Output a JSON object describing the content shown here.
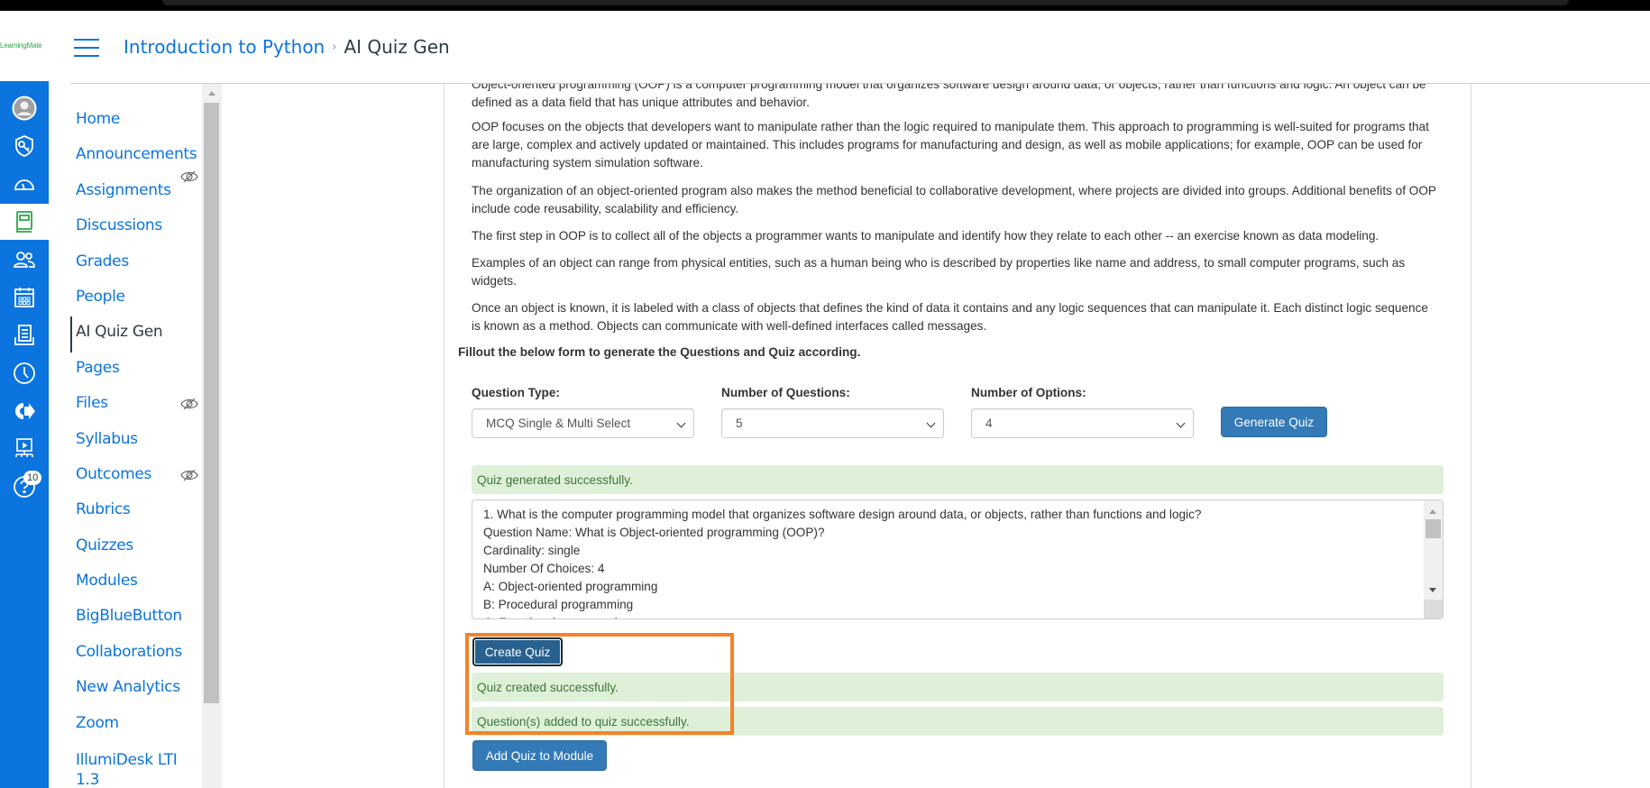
{
  "brand": {
    "logo_text": "LearningMate",
    "accent": "#0b74de",
    "highlight": "#f5822a"
  },
  "global_nav": {
    "items": [
      {
        "name": "account",
        "icon": "avatar-icon"
      },
      {
        "name": "admin",
        "icon": "shield-key-icon"
      },
      {
        "name": "dashboard",
        "icon": "speedometer-icon"
      },
      {
        "name": "courses",
        "icon": "book-icon",
        "active": true
      },
      {
        "name": "groups",
        "icon": "people-icon"
      },
      {
        "name": "calendar",
        "icon": "calendar-icon"
      },
      {
        "name": "inbox",
        "icon": "inbox-icon"
      },
      {
        "name": "history",
        "icon": "clock-icon"
      },
      {
        "name": "commons",
        "icon": "share-arrow-icon"
      },
      {
        "name": "studio",
        "icon": "presentation-icon"
      },
      {
        "name": "help",
        "icon": "help-icon",
        "badge": "10"
      }
    ]
  },
  "header": {
    "breadcrumb": [
      {
        "label": "Introduction to Python"
      },
      {
        "label": "AI Quiz Gen"
      }
    ],
    "separator": "›"
  },
  "course_nav": {
    "items": [
      {
        "label": "Home"
      },
      {
        "label": "Announcements"
      },
      {
        "label": "Assignments",
        "hidden": true
      },
      {
        "label": "Discussions"
      },
      {
        "label": "Grades"
      },
      {
        "label": "People"
      },
      {
        "label": "AI Quiz Gen",
        "active": true
      },
      {
        "label": "Pages"
      },
      {
        "label": "Files",
        "hidden": true
      },
      {
        "label": "Syllabus"
      },
      {
        "label": "Outcomes",
        "hidden": true
      },
      {
        "label": "Rubrics"
      },
      {
        "label": "Quizzes"
      },
      {
        "label": "Modules"
      },
      {
        "label": "BigBlueButton"
      },
      {
        "label": "Collaborations"
      },
      {
        "label": "New Analytics"
      },
      {
        "label": "Zoom"
      },
      {
        "label": "IllumiDesk LTI 1.3"
      }
    ]
  },
  "content": {
    "paragraphs": [
      "Object-oriented programming (OOP) is a computer programming model that organizes software design around data, or objects, rather than functions and logic. An object can be defined as a data field that has unique attributes and behavior.",
      "OOP focuses on the objects that developers want to manipulate rather than the logic required to manipulate them. This approach to programming is well-suited for programs that are large, complex and actively updated or maintained. This includes programs for manufacturing and design, as well as mobile applications; for example, OOP can be used for manufacturing system simulation software.",
      "The organization of an object-oriented program also makes the method beneficial to collaborative development, where projects are divided into groups. Additional benefits of OOP include code reusability, scalability and efficiency.",
      "The first step in OOP is to collect all of the objects a programmer wants to manipulate and identify how they relate to each other -- an exercise known as data modeling.",
      "Examples of an object can range from physical entities, such as a human being who is described by properties like name and address, to small computer programs, such as widgets.",
      "Once an object is known, it is labeled with a class of objects that defines the kind of data it contains and any logic sequences that can manipulate it. Each distinct logic sequence is known as a method. Objects can communicate with well-defined interfaces called messages."
    ],
    "instruction": "Fillout the below form to generate the Questions and Quiz according.",
    "form": {
      "question_type": {
        "label": "Question Type:",
        "value": "MCQ Single & Multi Select"
      },
      "num_questions": {
        "label": "Number of Questions:",
        "value": "5"
      },
      "num_options": {
        "label": "Number of Options:",
        "value": "4"
      },
      "generate_label": "Generate Quiz"
    },
    "generated_alert": "Quiz generated successfully.",
    "output_lines": [
      "1. What is the computer programming model that organizes software design around data, or objects, rather than functions and logic?",
      "Question Name: What is Object-oriented programming (OOP)?",
      "Cardinality: single",
      "Number Of Choices: 4",
      "A: Object-oriented programming",
      "B: Procedural programming",
      "C: Functional programming"
    ],
    "create_label": "Create Quiz",
    "created_alert": "Quiz created successfully.",
    "questions_added_alert": "Question(s) added to quiz successfully.",
    "add_module_label": "Add Quiz to Module"
  }
}
